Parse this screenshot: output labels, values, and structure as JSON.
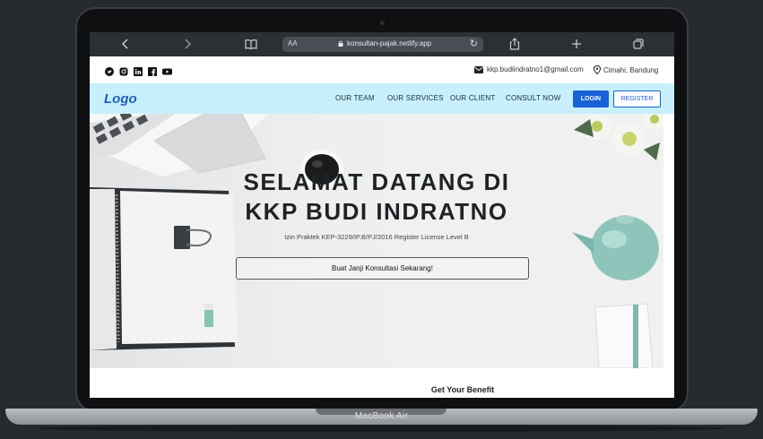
{
  "device": {
    "label": "MacBook Air"
  },
  "browser": {
    "url_aa": "AA",
    "url": "konsultan-pajak.netlify.app"
  },
  "topbar": {
    "social_icons": [
      "twitter-icon",
      "instagram-icon",
      "linkedin-icon",
      "facebook-icon",
      "youtube-icon"
    ],
    "email": "kkp.budiindratno1@gmail.com",
    "location": "Cimahi, Bandung"
  },
  "nav": {
    "logo": "Logo",
    "links": [
      "OUR TEAM",
      "OUR SERVICES",
      "OUR CLIENT",
      "CONSULT NOW"
    ],
    "login": "LOGIN",
    "register": "REGISTER"
  },
  "hero": {
    "title_line1": "SELAMAT DATANG DI",
    "title_line2": "KKP BUDI INDRATNO",
    "subtitle": "Izin Praktek KEP-3229/IP.B/PJ/2016 Register License Level B",
    "cta": "Buat Janji Konsultasi Sekarang!"
  },
  "section": {
    "benefit_title": "Get Your Benefit"
  },
  "colors": {
    "nav_bg": "#c7f0fc",
    "primary": "#1760d6",
    "logo": "#1d5fbd"
  }
}
